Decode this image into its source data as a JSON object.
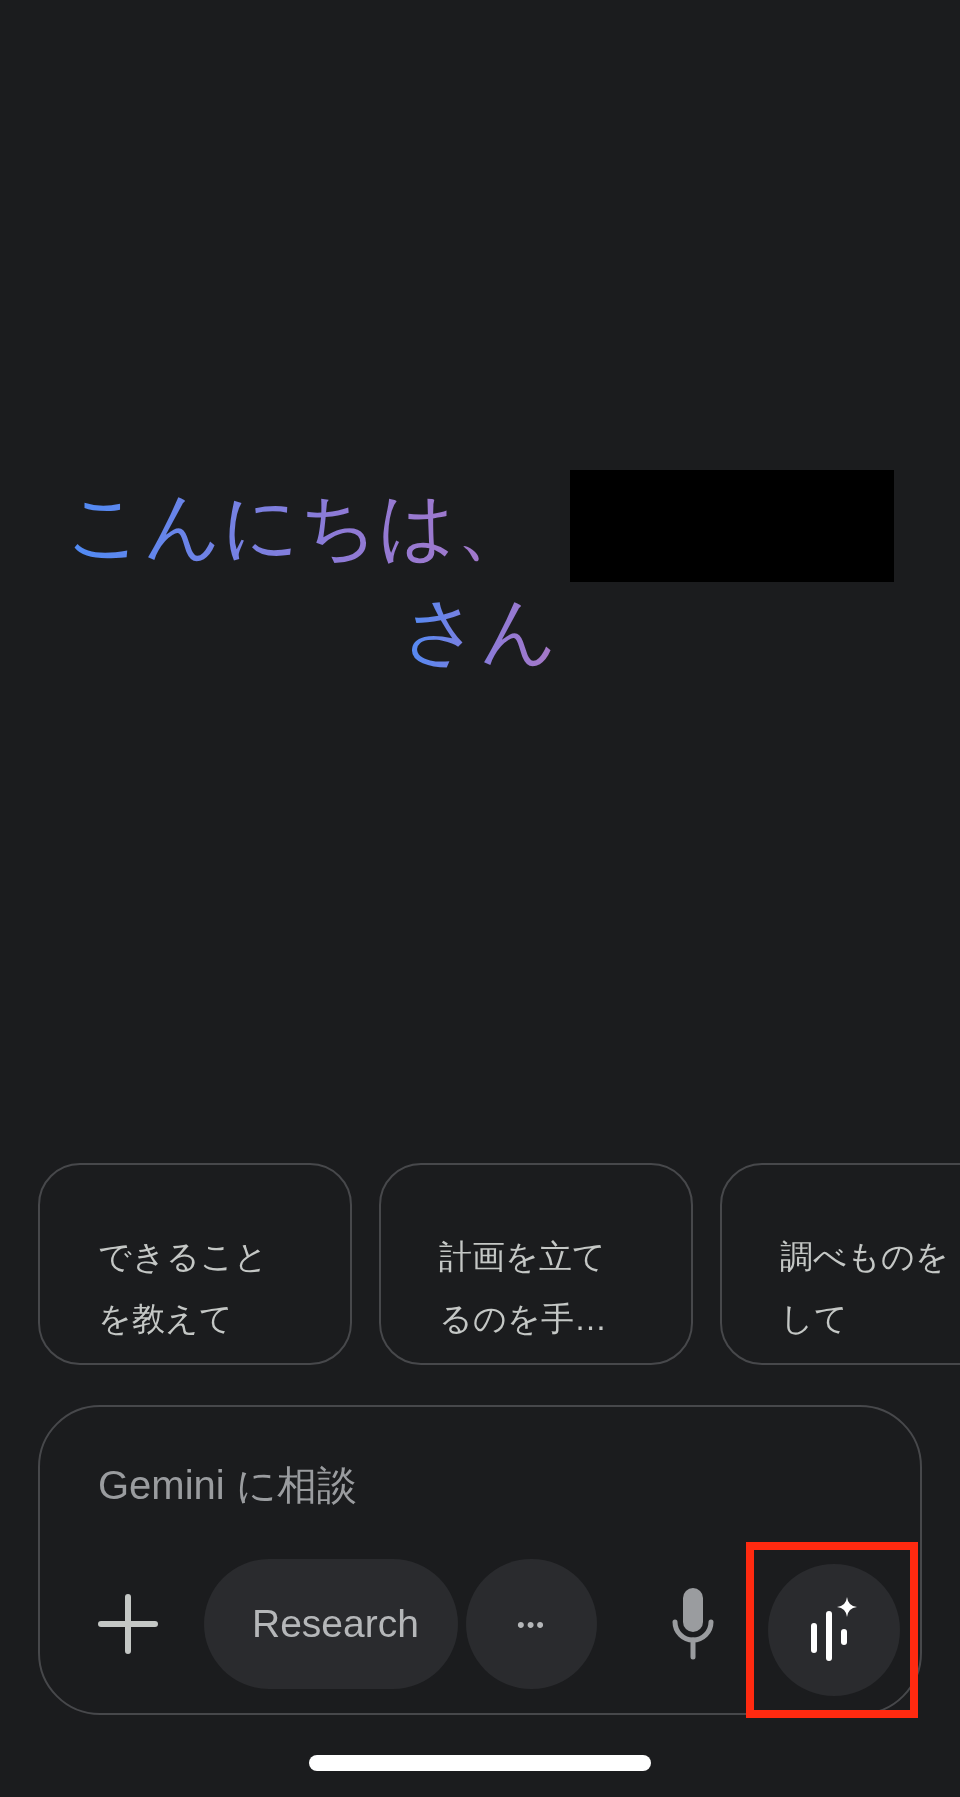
{
  "greeting": {
    "line_1": "こんにちは、",
    "redacted": true,
    "line_2": "さん"
  },
  "suggestions": [
    {
      "lines": [
        "できること",
        "を教えて"
      ]
    },
    {
      "lines": [
        "計画を立て",
        "るのを手…"
      ]
    },
    {
      "lines": [
        "調べものを",
        "して"
      ]
    }
  ],
  "composer": {
    "placeholder": "Gemini に相談",
    "research_label": "Research",
    "more_label": "•••",
    "live_highlighted": true
  }
}
